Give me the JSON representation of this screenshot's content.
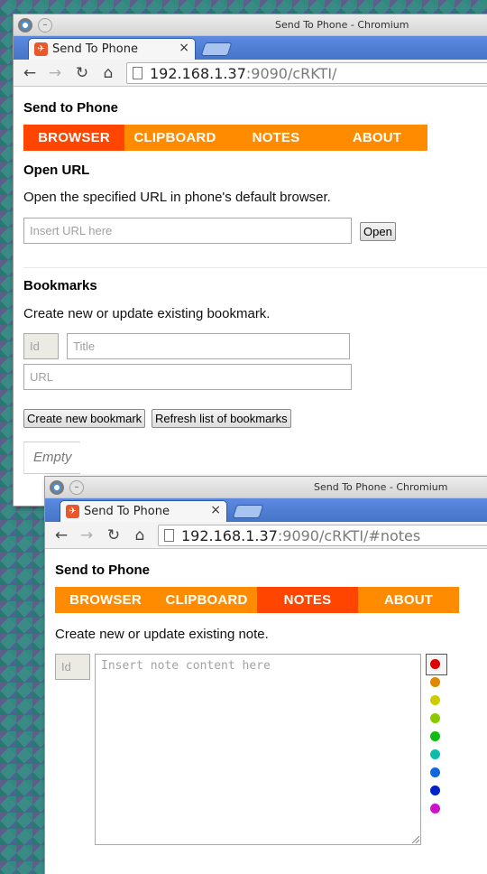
{
  "window1": {
    "title": "Send To Phone - Chromium",
    "tab_title": "Send To Phone",
    "tab_close": "×",
    "url_host": "192.168.1.37",
    "url_path": ":9090/cRKTI/",
    "app_title": "Send to Phone",
    "nav": [
      "BROWSER",
      "CLIPBOARD",
      "NOTES",
      "ABOUT"
    ],
    "active_nav": "BROWSER",
    "open_url": {
      "heading": "Open URL",
      "description": "Open the specified URL in phone's default browser.",
      "url_placeholder": "Insert URL here",
      "open_button": "Open"
    },
    "bookmarks": {
      "heading": "Bookmarks",
      "description": "Create new or update existing bookmark.",
      "id_placeholder": "Id",
      "title_placeholder": "Title",
      "url_placeholder": "URL",
      "create_button": "Create new bookmark",
      "refresh_button": "Refresh list of bookmarks",
      "empty_text": "Empty"
    }
  },
  "window2": {
    "title": "Send To Phone - Chromium",
    "tab_title": "Send To Phone",
    "tab_close": "×",
    "url_host": "192.168.1.37",
    "url_path": ":9090/cRKTI/#notes",
    "app_title": "Send to Phone",
    "nav": [
      "BROWSER",
      "CLIPBOARD",
      "NOTES",
      "ABOUT"
    ],
    "active_nav": "NOTES",
    "notes": {
      "description": "Create new or update existing note.",
      "id_placeholder": "Id",
      "content_placeholder": "Insert note content here",
      "colors": [
        "#dd0000",
        "#dd8800",
        "#cccc00",
        "#88cc00",
        "#11bb11",
        "#11bbaa",
        "#1166dd",
        "#0022cc",
        "#cc11cc"
      ],
      "selected_color": "#dd0000"
    }
  },
  "icons": {
    "back": "←",
    "forward": "→",
    "reload": "↻",
    "home": "⌂",
    "minimize": "–"
  }
}
